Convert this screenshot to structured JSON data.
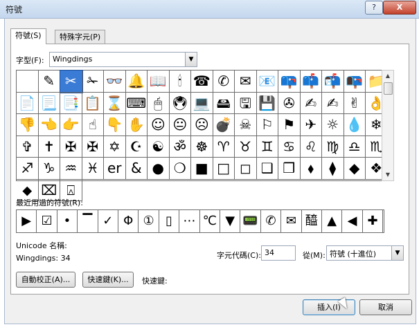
{
  "window": {
    "title": "符號",
    "help_label": "?",
    "close_label": "X"
  },
  "tabs": [
    {
      "label": "符號(S)"
    },
    {
      "label": "特殊字元(P)"
    }
  ],
  "font": {
    "label": "字型(F):",
    "value": "Wingdings"
  },
  "symbols": [
    "",
    "✎",
    "✂",
    "✁",
    "👓",
    "🔔",
    "📖",
    "🕯",
    "☎",
    "✆",
    "✉",
    "📧",
    "📪",
    "📫",
    "📬",
    "📭",
    "📁",
    "📄",
    "📃",
    "📑",
    "📋",
    "⌛",
    "⌨",
    "🖱",
    "🖲",
    "💻",
    "🖴",
    "🖫",
    "💾",
    "✇",
    "✍",
    "✍",
    "✌",
    "👌",
    "👎",
    "👈",
    "👉",
    "☝",
    "👇",
    "✋",
    "☺",
    "😐",
    "☹",
    "💣",
    "☠",
    "⚐",
    "⚑",
    "✈",
    "☼",
    "💧",
    "❄",
    "✞",
    "✝",
    "✠",
    "✠",
    "✡",
    "☪",
    "☯",
    "ॐ",
    "☸",
    "♈",
    "♉",
    "♊",
    "♋",
    "♌",
    "♍",
    "♎",
    "♏",
    "♐",
    "♑",
    "♒",
    "♓",
    "er",
    "&",
    "●",
    "❍",
    "■",
    "□",
    "◻",
    "❑",
    "❒",
    "⬧",
    "⧫",
    "◆",
    "❖",
    "⬥",
    "⌧",
    "⍓"
  ],
  "recent": {
    "label": "最近用過的符號(R):",
    "items": [
      "▶",
      "☑",
      "•",
      "▔",
      "✓",
      "Φ",
      "①",
      "▯",
      "⋯",
      "℃",
      "▼",
      "📟",
      "✆",
      "✉",
      "醯",
      "▲",
      "◀",
      "✚"
    ]
  },
  "info": {
    "unicode_name_label": "Unicode 名稱:",
    "charset_line": "Wingdings: 34"
  },
  "charcode": {
    "label": "字元代碼(C):",
    "value": "34"
  },
  "from": {
    "label": "從(M):",
    "value": "符號 (十進位)"
  },
  "buttons": {
    "autocorrect": "自動校正(A)...",
    "shortcut": "快速鍵(K)...",
    "shortcut_label": "快速鍵:",
    "insert": "插入(I)",
    "cancel": "取消"
  }
}
